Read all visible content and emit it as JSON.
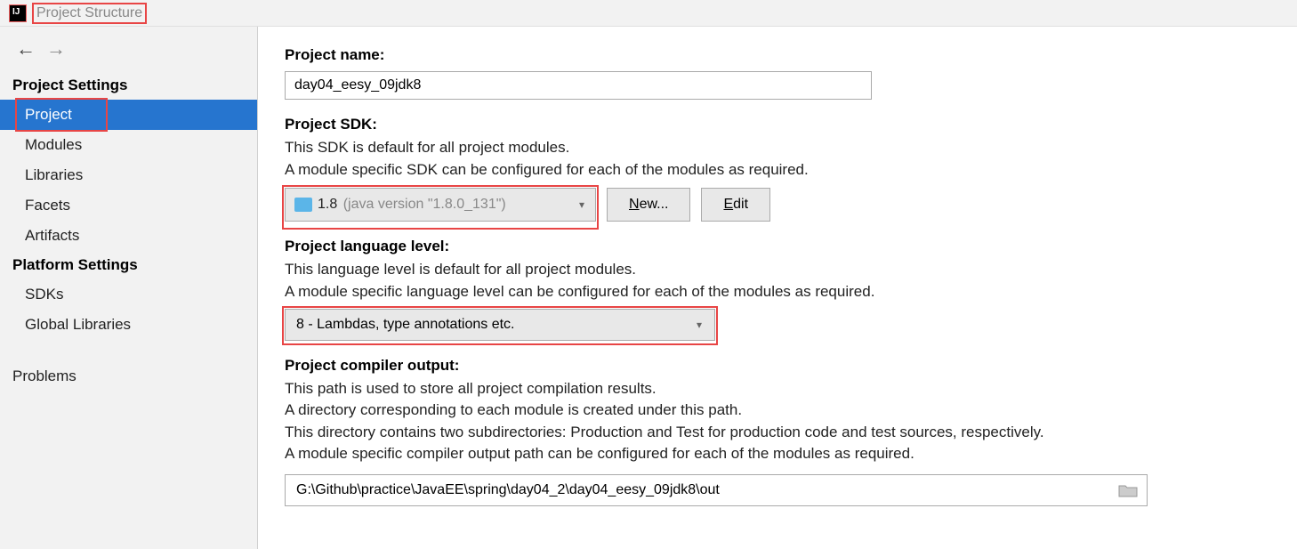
{
  "window_title": "Project Structure",
  "sidebar": {
    "sections": [
      {
        "header": "Project Settings",
        "items": [
          "Project",
          "Modules",
          "Libraries",
          "Facets",
          "Artifacts"
        ],
        "selected": "Project"
      },
      {
        "header": "Platform Settings",
        "items": [
          "SDKs",
          "Global Libraries"
        ]
      }
    ],
    "problems": "Problems"
  },
  "content": {
    "project_name_label": "Project name:",
    "project_name_value": "day04_eesy_09jdk8",
    "sdk_label": "Project SDK:",
    "sdk_desc1": "This SDK is default for all project modules.",
    "sdk_desc2": "A module specific SDK can be configured for each of the modules as required.",
    "sdk_version": "1.8",
    "sdk_detail": "(java version \"1.8.0_131\")",
    "new_btn": "New...",
    "edit_btn": "Edit",
    "lang_label": "Project language level:",
    "lang_desc1": "This language level is default for all project modules.",
    "lang_desc2": "A module specific language level can be configured for each of the modules as required.",
    "lang_value": "8 - Lambdas, type annotations etc.",
    "output_label": "Project compiler output:",
    "output_desc1": "This path is used to store all project compilation results.",
    "output_desc2": "A directory corresponding to each module is created under this path.",
    "output_desc3": "This directory contains two subdirectories: Production and Test for production code and test sources, respectively.",
    "output_desc4": "A module specific compiler output path can be configured for each of the modules as required.",
    "output_value": "G:\\Github\\practice\\JavaEE\\spring\\day04_2\\day04_eesy_09jdk8\\out"
  }
}
